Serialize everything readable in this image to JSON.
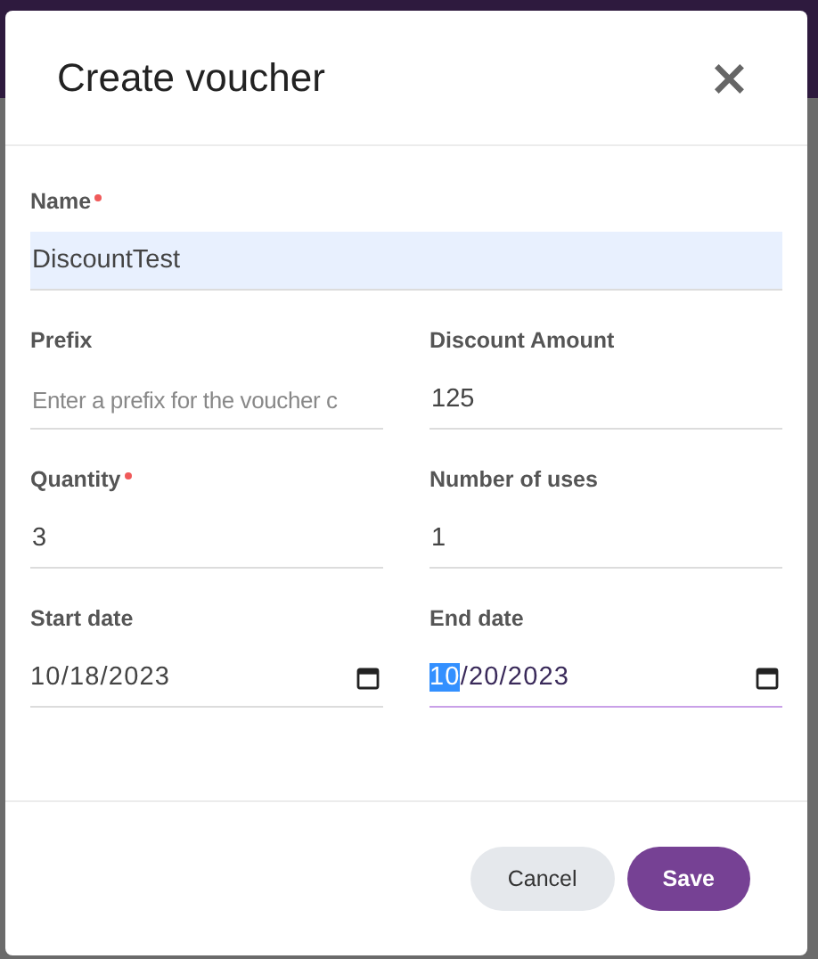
{
  "dialog": {
    "title": "Create voucher",
    "close": "×"
  },
  "name_field": {
    "label": "Name",
    "required": true,
    "value": "DiscountTest"
  },
  "fields": [
    {
      "kind": "text",
      "label": "Prefix",
      "required": false,
      "placeholder": "Enter a prefix for the voucher c"
    },
    {
      "kind": "text",
      "label": "Discount Amount",
      "required": false,
      "value": "125"
    },
    {
      "kind": "text",
      "label": "Quantity",
      "required": true,
      "value": "3"
    },
    {
      "kind": "text",
      "label": "Number of uses",
      "required": false,
      "value": "1"
    },
    {
      "kind": "date",
      "label": "Start date",
      "required": false,
      "value": "10/18/2023",
      "focused": false
    },
    {
      "kind": "date",
      "label": "End date",
      "required": false,
      "value": "10/20/2023",
      "focused": true
    }
  ],
  "buttons": [
    {
      "label": "Cancel",
      "kind": "secondary"
    },
    {
      "label": "Save",
      "kind": "primary"
    }
  ]
}
